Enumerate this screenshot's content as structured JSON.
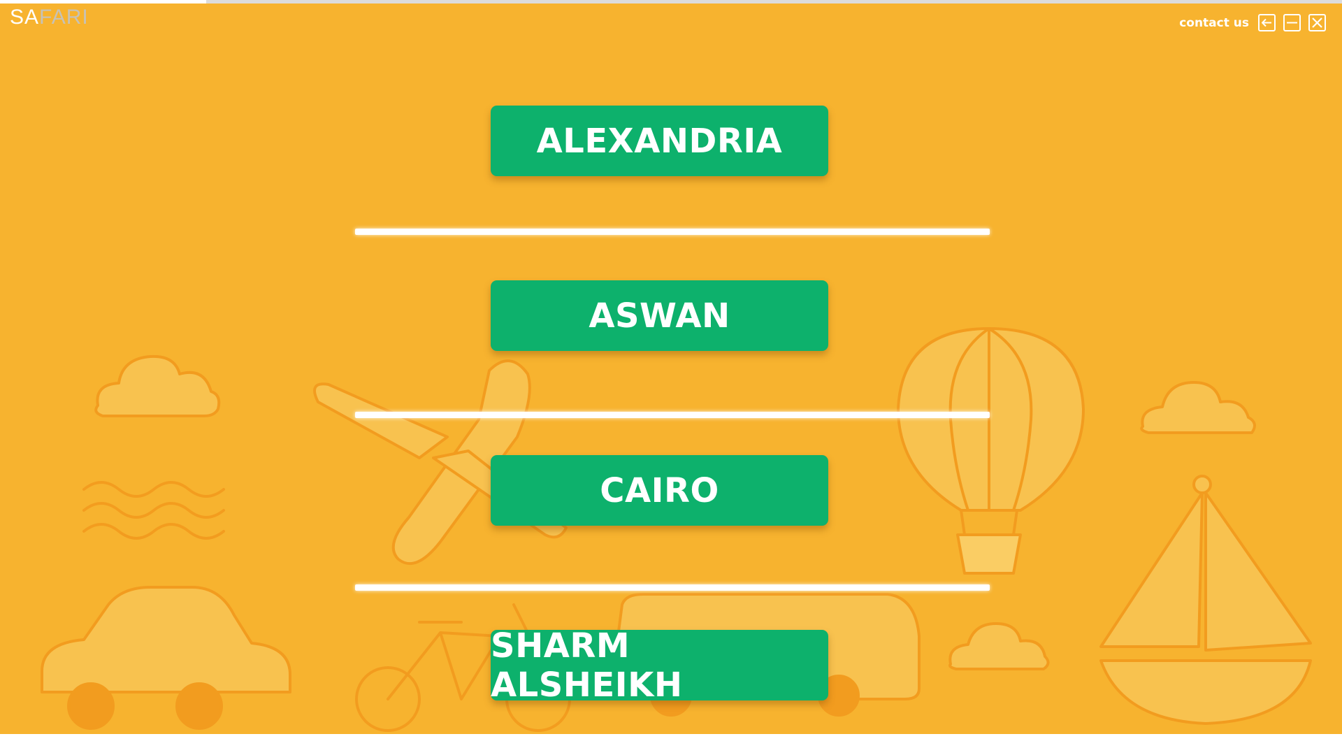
{
  "app": {
    "logo": {
      "part1": "SA",
      "part2": "FARI"
    },
    "header": {
      "contact_label": "contact us"
    },
    "window_controls": [
      "back-icon",
      "minimize-icon",
      "close-icon"
    ]
  },
  "destinations": [
    {
      "label": "ALEXANDRIA"
    },
    {
      "label": "ASWAN"
    },
    {
      "label": "CAIRO"
    },
    {
      "label": "SHARM ALSHEIKH"
    }
  ],
  "theme": {
    "background": "#f7b32f",
    "button": "#0db16c",
    "button_text": "#ffffff",
    "divider": "#ffffff",
    "illustration_stroke": "#f29a1e"
  }
}
